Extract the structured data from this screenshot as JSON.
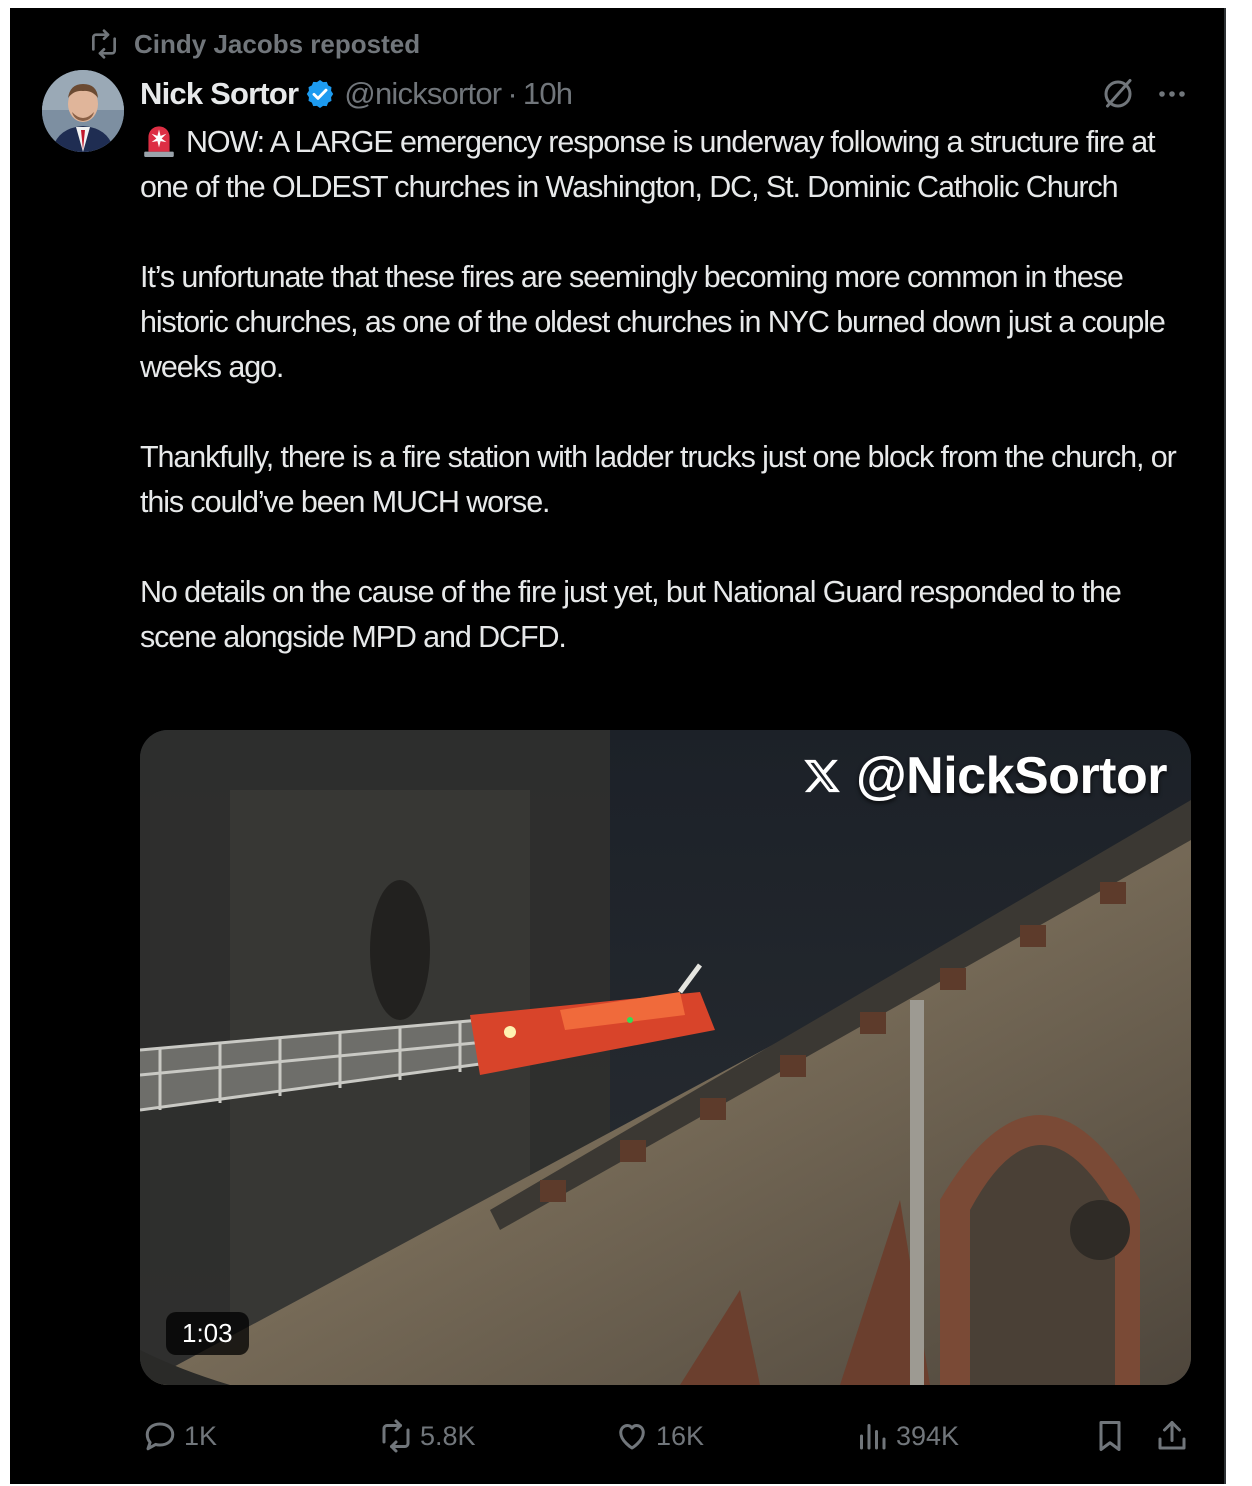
{
  "repost": {
    "text": "Cindy Jacobs reposted",
    "icon": "repost-icon"
  },
  "author": {
    "name": "Nick Sortor",
    "handle": "@nicksortor",
    "separator": "·",
    "time": "10h"
  },
  "tweet": {
    "paragraphs": [
      "NOW: A LARGE emergency response is underway following a structure fire at one of the OLDEST churches in Washington, DC, St. Dominic Catholic Church",
      "It’s unfortunate that these fires are seemingly becoming more common in these historic churches, as one of the oldest churches in NYC burned down just a couple weeks ago.",
      "Thankfully, there is a fire station with ladder trucks just one block from the church, or this could’ve been MUCH worse.",
      "No details on the cause of the fire just yet, but National Guard responded to the scene alongside MPD and DCFD."
    ]
  },
  "media": {
    "watermark": "@NickSortor",
    "duration": "1:03"
  },
  "actions": {
    "replies": "1K",
    "reposts": "5.8K",
    "likes": "16K",
    "views": "394K"
  },
  "colors": {
    "background": "#000000",
    "text": "#e7e9ea",
    "muted": "#71767b",
    "verified": "#1d9bf0"
  }
}
